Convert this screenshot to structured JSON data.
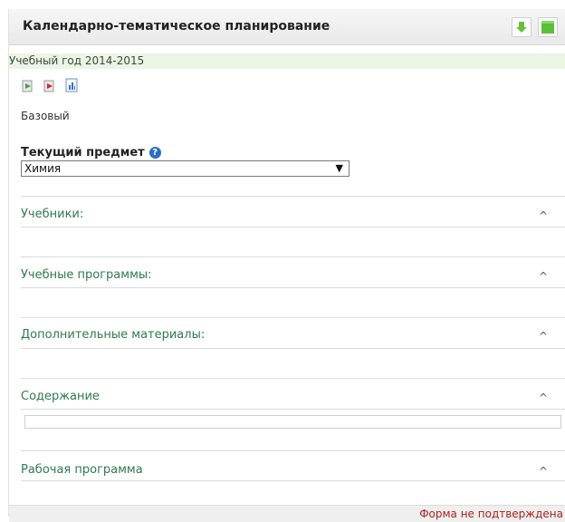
{
  "window": {
    "title": "Календарно-тематическое планирование"
  },
  "header": {
    "collapse_icon": "arrow-down-icon",
    "maximize_icon": "green-square-icon"
  },
  "year": {
    "text": "Учебный год 2014-2015"
  },
  "toolbar": {
    "icons": [
      "import-icon",
      "export-icon",
      "report-icon"
    ]
  },
  "level": {
    "text": "Базовый"
  },
  "subject": {
    "label": "Текущий предмет",
    "help_icon": "help-icon",
    "selected": "Химия"
  },
  "sections": [
    {
      "title": "Учебники:",
      "chevron": "^"
    },
    {
      "title": "Учебные программы:",
      "chevron": "^"
    },
    {
      "title": "Дополнительные материалы:",
      "chevron": "^"
    },
    {
      "title": "Содержание",
      "chevron": "^"
    },
    {
      "title": "Рабочая программа",
      "chevron": "^"
    }
  ],
  "footer": {
    "status": "Форма не подтверждена"
  },
  "colors": {
    "section_title": "#2f7a4e",
    "year_bar": "#eaf6e3",
    "status_text": "#b02020"
  }
}
